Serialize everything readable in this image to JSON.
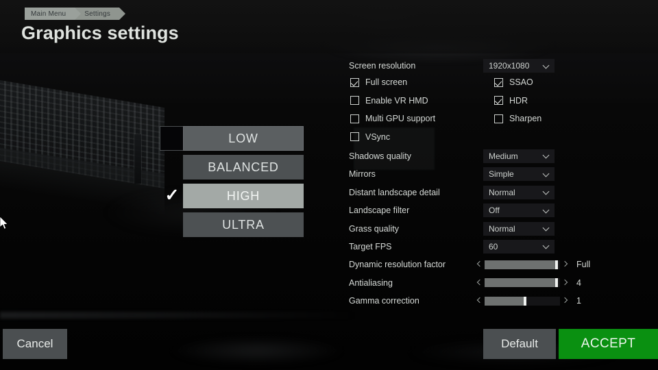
{
  "breadcrumb": {
    "items": [
      {
        "label": "Main Menu"
      },
      {
        "label": "Settings"
      }
    ]
  },
  "header": {
    "title": "Graphics settings"
  },
  "presets": {
    "items": [
      {
        "label": "LOW",
        "selected": false
      },
      {
        "label": "BALANCED",
        "selected": false
      },
      {
        "label": "HIGH",
        "selected": true
      },
      {
        "label": "ULTRA",
        "selected": false
      }
    ],
    "check_glyph": "✓"
  },
  "settings": {
    "screen_resolution": {
      "label": "Screen resolution",
      "value": "1920x1080"
    },
    "checkboxes": {
      "full_screen": {
        "label": "Full screen",
        "checked": true
      },
      "enable_vr_hmd": {
        "label": "Enable VR HMD",
        "checked": false
      },
      "multi_gpu": {
        "label": "Multi GPU support",
        "checked": false
      },
      "vsync": {
        "label": "VSync",
        "checked": false
      },
      "ssao": {
        "label": "SSAO",
        "checked": true
      },
      "hdr": {
        "label": "HDR",
        "checked": true
      },
      "sharpen": {
        "label": "Sharpen",
        "checked": false
      }
    },
    "dropdowns": [
      {
        "label": "Shadows quality",
        "value": "Medium"
      },
      {
        "label": "Mirrors",
        "value": "Simple"
      },
      {
        "label": "Distant landscape detail",
        "value": "Normal"
      },
      {
        "label": "Landscape filter",
        "value": "Off"
      },
      {
        "label": "Grass quality",
        "value": "Normal"
      },
      {
        "label": "Target FPS",
        "value": "60"
      }
    ],
    "sliders": [
      {
        "label": "Dynamic resolution factor",
        "value": "Full",
        "percent": 97
      },
      {
        "label": "Antialiasing",
        "value": "4",
        "percent": 97
      },
      {
        "label": "Gamma correction",
        "value": "1",
        "percent": 55
      }
    ]
  },
  "footer": {
    "cancel_label": "Cancel",
    "default_label": "Default",
    "accept_label": "ACCEPT"
  },
  "colors": {
    "accent_green": "#0a9011",
    "button_gray": "#4b4f51",
    "selected_preset": "#a3a9a6",
    "breadcrumb_gray": "#9aa09b",
    "text": "#d6dad7"
  }
}
